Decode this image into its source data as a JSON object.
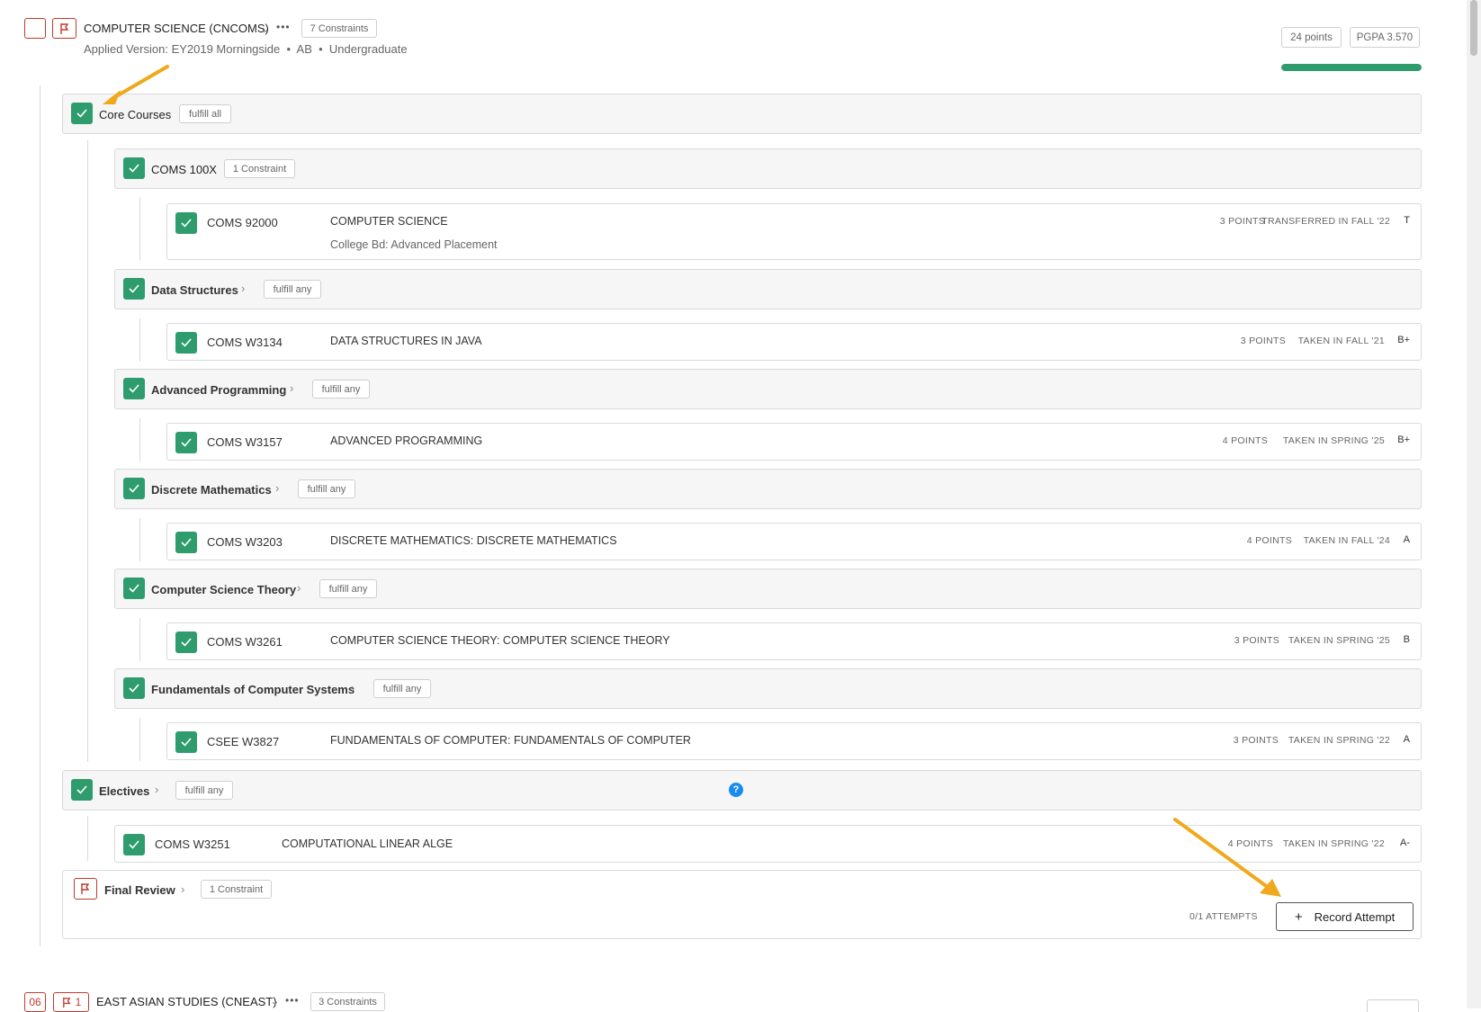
{
  "program": {
    "title": "COMPUTER SCIENCE (CNCOMS)",
    "more": "•••",
    "constraints": "7 Constraints",
    "subtitle": "Applied Version: EY2019 Morningside  •  AB  •  Undergraduate",
    "points": "24 points",
    "pgpa": "PGPA 3.570",
    "progress": 1.0
  },
  "core": {
    "title": "Core Courses",
    "tag": "fulfill all",
    "groups": [
      {
        "title": "COMS 100X",
        "tag": "1 Constraint",
        "course": {
          "code": "COMS 92000",
          "name": "COMPUTER SCIENCE",
          "sub": "College Bd: Advanced Placement",
          "points": "3 POINTS",
          "status": "TRANSFERRED IN FALL '22",
          "grade": "T"
        }
      },
      {
        "title": "Data Structures",
        "tag": "fulfill any",
        "course": {
          "code": "COMS W3134",
          "name": "DATA STRUCTURES IN JAVA",
          "points": "3 POINTS",
          "status": "TAKEN IN FALL '21",
          "grade": "B+"
        }
      },
      {
        "title": "Advanced Programming",
        "tag": "fulfill any",
        "course": {
          "code": "COMS W3157",
          "name": "ADVANCED PROGRAMMING",
          "points": "4 POINTS",
          "status": "TAKEN IN SPRING '25",
          "grade": "B+"
        }
      },
      {
        "title": "Discrete Mathematics",
        "tag": "fulfill any",
        "course": {
          "code": "COMS W3203",
          "name": "DISCRETE MATHEMATICS: DISCRETE MATHEMATICS",
          "points": "4 POINTS",
          "status": "TAKEN IN FALL '24",
          "grade": "A"
        }
      },
      {
        "title": "Computer Science Theory",
        "tag": "fulfill any",
        "course": {
          "code": "COMS W3261",
          "name": "COMPUTER SCIENCE THEORY: COMPUTER SCIENCE THEORY",
          "points": "3 POINTS",
          "status": "TAKEN IN SPRING '25",
          "grade": "B"
        }
      },
      {
        "title": "Fundamentals of Computer Systems",
        "tag": "fulfill any",
        "course": {
          "code": "CSEE W3827",
          "name": "FUNDAMENTALS OF COMPUTER: FUNDAMENTALS OF COMPUTER",
          "points": "3 POINTS",
          "status": "TAKEN IN SPRING '22",
          "grade": "A"
        }
      }
    ]
  },
  "electives": {
    "title": "Electives",
    "tag": "fulfill any",
    "help": "?",
    "course": {
      "code": "COMS W3251",
      "name": "COMPUTATIONAL LINEAR ALGE",
      "points": "4 POINTS",
      "status": "TAKEN IN SPRING '22",
      "grade": "A-"
    }
  },
  "final_review": {
    "title": "Final Review",
    "tag": "1 Constraint",
    "attempts": "0/1 ATTEMPTS",
    "button": "Record Attempt",
    "button_icon": "+"
  },
  "next_program": {
    "badge_num": "06",
    "flag_count": "1",
    "title": "EAST ASIAN STUDIES (CNEAST)",
    "more": "•••",
    "constraints": "3 Constraints"
  },
  "colors": {
    "check_green": "#2f9c6e",
    "flag_red": "#c0392b",
    "arrow_orange": "#f0a81c",
    "help_blue": "#1a8cf0"
  }
}
